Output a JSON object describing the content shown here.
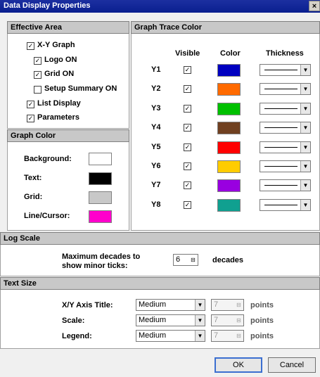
{
  "window": {
    "title": "Data Display Properties",
    "close_glyph": "×"
  },
  "effective_area": {
    "header": "Effective Area",
    "items": [
      {
        "label": "X-Y Graph",
        "checked": true
      },
      {
        "label": "Logo ON",
        "checked": true
      },
      {
        "label": "Grid ON",
        "checked": true
      },
      {
        "label": "Setup Summary ON",
        "checked": false
      },
      {
        "label": "List Display",
        "checked": true
      },
      {
        "label": "Parameters",
        "checked": true
      }
    ]
  },
  "graph_color": {
    "header": "Graph Color",
    "items": [
      {
        "label": "Background:",
        "color": "#ffffff"
      },
      {
        "label": "Text:",
        "color": "#000000"
      },
      {
        "label": "Grid:",
        "color": "#c8c8c8"
      },
      {
        "label": "Line/Cursor:",
        "color": "#ff00cc"
      }
    ]
  },
  "graph_trace_color": {
    "header": "Graph Trace Color",
    "col_visible": "Visible",
    "col_color": "Color",
    "col_thickness": "Thickness",
    "rows": [
      {
        "label": "Y1",
        "visible": true,
        "color": "#0000c0"
      },
      {
        "label": "Y2",
        "visible": true,
        "color": "#ff6a00"
      },
      {
        "label": "Y3",
        "visible": true,
        "color": "#00c000"
      },
      {
        "label": "Y4",
        "visible": true,
        "color": "#704020"
      },
      {
        "label": "Y5",
        "visible": true,
        "color": "#ff0000"
      },
      {
        "label": "Y6",
        "visible": true,
        "color": "#ffcc00"
      },
      {
        "label": "Y7",
        "visible": true,
        "color": "#9900e0"
      },
      {
        "label": "Y8",
        "visible": true,
        "color": "#10a090"
      }
    ]
  },
  "log_scale": {
    "header": "Log Scale",
    "label_line1": "Maximum decades to",
    "label_line2": "show minor ticks:",
    "value": "6",
    "unit": "decades"
  },
  "text_size": {
    "header": "Text Size",
    "rows": [
      {
        "label": "X/Y Axis Title:",
        "size": "Medium",
        "points": "7",
        "unit": "points"
      },
      {
        "label": "Scale:",
        "size": "Medium",
        "points": "7",
        "unit": "points"
      },
      {
        "label": "Legend:",
        "size": "Medium",
        "points": "7",
        "unit": "points"
      }
    ]
  },
  "buttons": {
    "ok": "OK",
    "cancel": "Cancel"
  },
  "glyphs": {
    "check": "✓",
    "dropdown": "▼",
    "spinner": "⊟"
  }
}
